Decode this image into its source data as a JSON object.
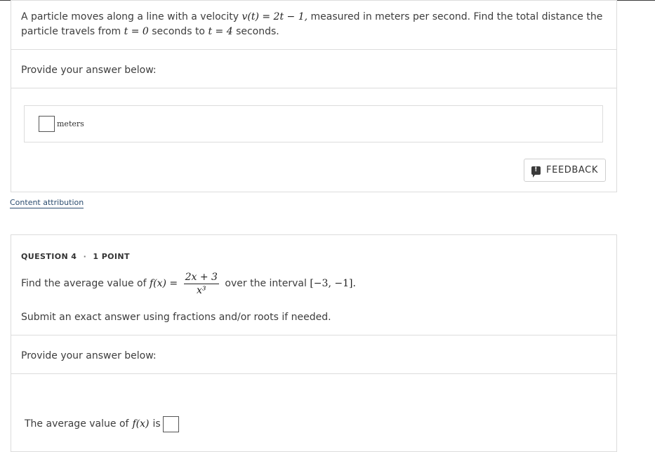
{
  "q3": {
    "text_part1": "A particle moves along a line with a velocity",
    "velocity_math": "v(t) = 2t − 1,",
    "text_part2": "measured in meters per second. Find the total distance the",
    "text_line2_a": "particle travels from",
    "t_start": "t = 0",
    "text_line2_b": "seconds to",
    "t_end": "t = 4",
    "text_line2_c": "seconds.",
    "provide_label": "Provide your answer below:",
    "unit_label": "meters",
    "feedback_label": "FEEDBACK"
  },
  "attribution_link": "Content attribution",
  "q4": {
    "header": "QUESTION 4",
    "separator": "·",
    "points": "1 POINT",
    "text_a": "Find the average value of",
    "func_lhs": "f(x) =",
    "numerator": "2x + 3",
    "denominator": "x³",
    "text_b": "over the interval",
    "interval": "[−3, −1].",
    "instruction": "Submit an exact answer using fractions and/or roots if needed.",
    "provide_label": "Provide your answer below:",
    "answer_prefix": "The average value of",
    "answer_func": "f(x)",
    "answer_suffix": "is"
  },
  "colors": {
    "border": "#dcdcdc",
    "link": "#2b4c6f",
    "text": "#3d3d3d"
  }
}
